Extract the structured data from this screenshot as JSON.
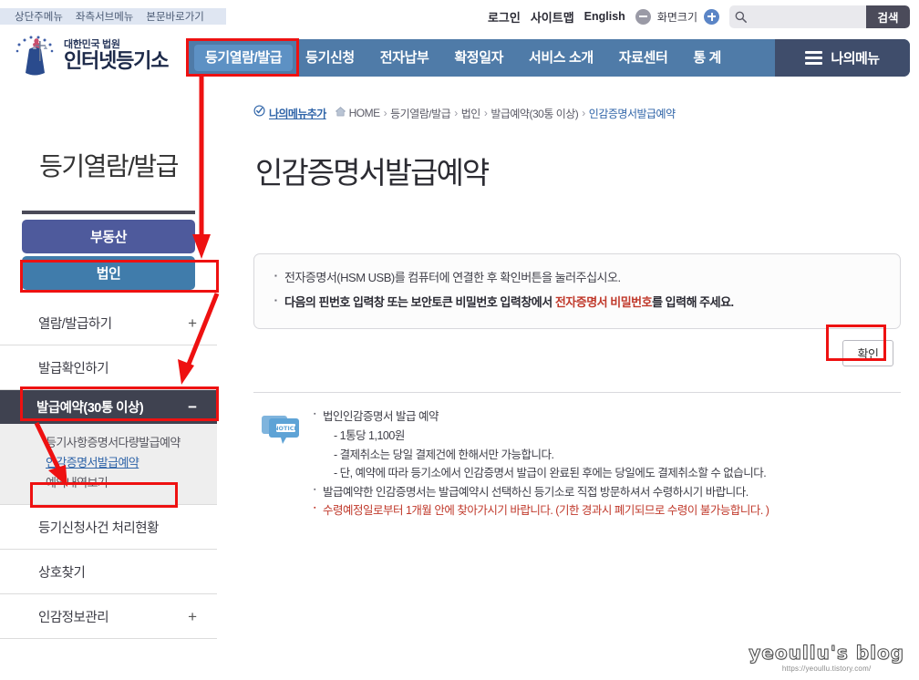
{
  "skip_links": [
    {
      "label": "상단주메뉴"
    },
    {
      "label": "좌측서브메뉴"
    },
    {
      "label": "본문바로가기"
    }
  ],
  "utility": {
    "login": "로그인",
    "sitemap": "사이트맵",
    "english": "English",
    "zoom_label": "화면크기",
    "minus_icon": "minus-circle-icon",
    "plus_icon": "plus-circle-icon",
    "search_icon": "search-icon",
    "search_value": "",
    "search_placeholder": "",
    "search_button": "검색"
  },
  "logo": {
    "sub": "대한민국 법원",
    "main": "인터넷등기소",
    "mark_icon": "court-scales-emblem-icon"
  },
  "gnb": {
    "items": [
      {
        "label": "등기열람/발급",
        "active": true
      },
      {
        "label": "등기신청",
        "active": false
      },
      {
        "label": "전자납부",
        "active": false
      },
      {
        "label": "확정일자",
        "active": false
      },
      {
        "label": "서비스 소개",
        "active": false
      },
      {
        "label": "자료센터",
        "active": false
      },
      {
        "label": "통 계",
        "active": false
      }
    ],
    "mymenu": "나의메뉴",
    "mymenu_icon": "hamburger-icon"
  },
  "sidebar": {
    "title": "등기열람/발급",
    "tabs": [
      {
        "label": "부동산",
        "color": "#4e5a9c"
      },
      {
        "label": "법인",
        "color": "#407cab"
      }
    ],
    "items": [
      {
        "label": "열람/발급하기",
        "sign": "+",
        "type": "row"
      },
      {
        "label": "발급확인하기",
        "sign": "",
        "type": "row"
      },
      {
        "label": "발급예약(30통 이상)",
        "sign": "−",
        "type": "dark"
      },
      {
        "label": "등기사항증명서다량발급예약",
        "type": "sub"
      },
      {
        "label": "인감증명서발급예약",
        "type": "sub",
        "active": true
      },
      {
        "label": "예약내역보기",
        "type": "sub"
      },
      {
        "label": "등기신청사건 처리현황",
        "sign": "",
        "type": "row"
      },
      {
        "label": "상호찾기",
        "sign": "",
        "type": "row"
      },
      {
        "label": "인감정보관리",
        "sign": "+",
        "type": "row"
      }
    ]
  },
  "breadcrumb": {
    "add_menu": "나의메뉴추가",
    "add_menu_icon": "check-circle-icon",
    "home_icon": "home-icon",
    "items": [
      {
        "label": "HOME"
      },
      {
        "label": "등기열람/발급"
      },
      {
        "label": "법인"
      },
      {
        "label": "발급예약(30통 이상)"
      },
      {
        "label": "인감증명서발급예약"
      }
    ]
  },
  "page": {
    "title": "인감증명서발급예약"
  },
  "infobox": {
    "line1": "전자증명서(HSM USB)를 컴퓨터에 연결한 후 확인버튼을 눌러주십시오.",
    "line2_pre": "다음의 핀번호 입력창 또는 보안토큰 비밀번호 입력창에서 ",
    "line2_hl": "전자증명서 비밀번호",
    "line2_post": "를 입력해 주세요.",
    "confirm_button": "확인"
  },
  "notice": {
    "icon": "notice-speech-bubble-icon",
    "icon_text": "NOTICE",
    "items": [
      {
        "text": "법인인감증명서 발급 예약",
        "level": 1,
        "red": false
      },
      {
        "text": "- 1통당 1,100원",
        "level": 2,
        "red": false
      },
      {
        "text": "- 결제취소는 당일 결제건에 한해서만 가능합니다.",
        "level": 2,
        "red": false
      },
      {
        "text": "- 단, 예약에 따라 등기소에서 인감증명서 발급이 완료된 후에는 당일에도 결제취소할 수 없습니다.",
        "level": 2,
        "red": false
      },
      {
        "text": "발급예약한 인감증명서는 발급예약시 선택하신 등기소로 직접 방문하셔서 수령하시기 바랍니다.",
        "level": 1,
        "red": false
      },
      {
        "text": "수령예정일로부터 1개월 안에 찾아가시기 바랍니다. (기한 경과시 폐기되므로 수령이 불가능합니다. )",
        "level": 1,
        "red": true
      }
    ]
  },
  "watermark": {
    "title": "yeoullu's blog",
    "url": "https://yeoullu.tistory.com/"
  },
  "annotations": {
    "accent_color": "#ee1111",
    "highlight_count": 4
  }
}
